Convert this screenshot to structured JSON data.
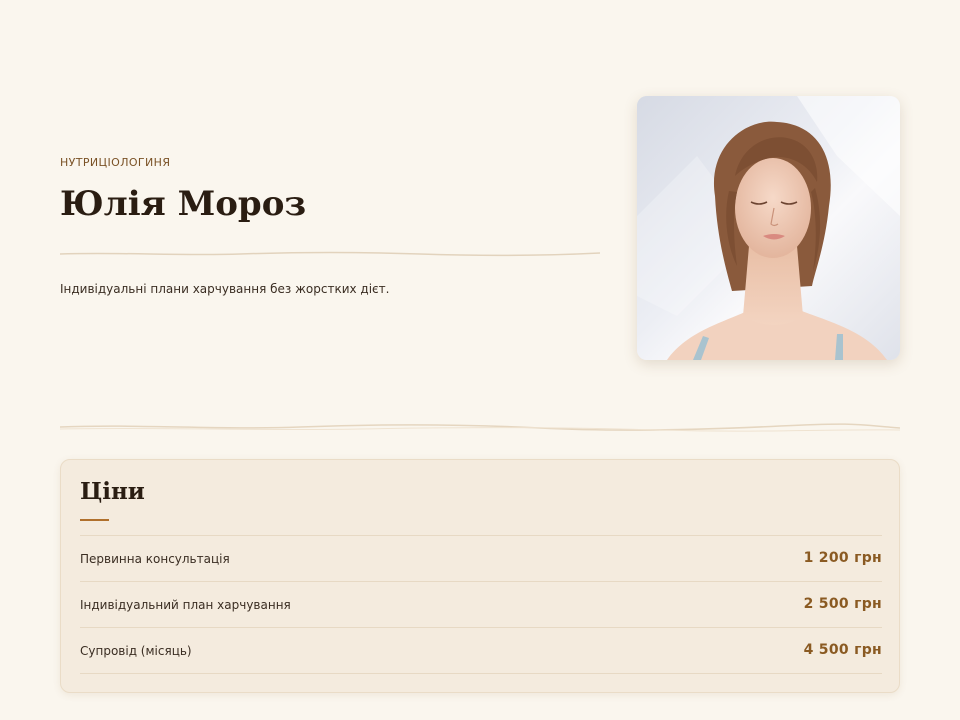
{
  "profile": {
    "eyebrow": "НУТРИЦІОЛОГИНЯ",
    "name": "Юлія Мороз",
    "tagline": "Індивідуальні плани харчування без жорстких дієт."
  },
  "prices": {
    "title": "Ціни",
    "items": [
      {
        "label": "Первинна консультація",
        "price": "1 200 грн"
      },
      {
        "label": "Індивідуальний план харчування",
        "price": "2 500 грн"
      },
      {
        "label": "Супровід (місяць)",
        "price": "4 500 грн"
      }
    ]
  },
  "colors": {
    "background": "#faf6ee",
    "accent": "#b0702c",
    "price_text": "#8a5a22",
    "card": "#f4ebde"
  }
}
